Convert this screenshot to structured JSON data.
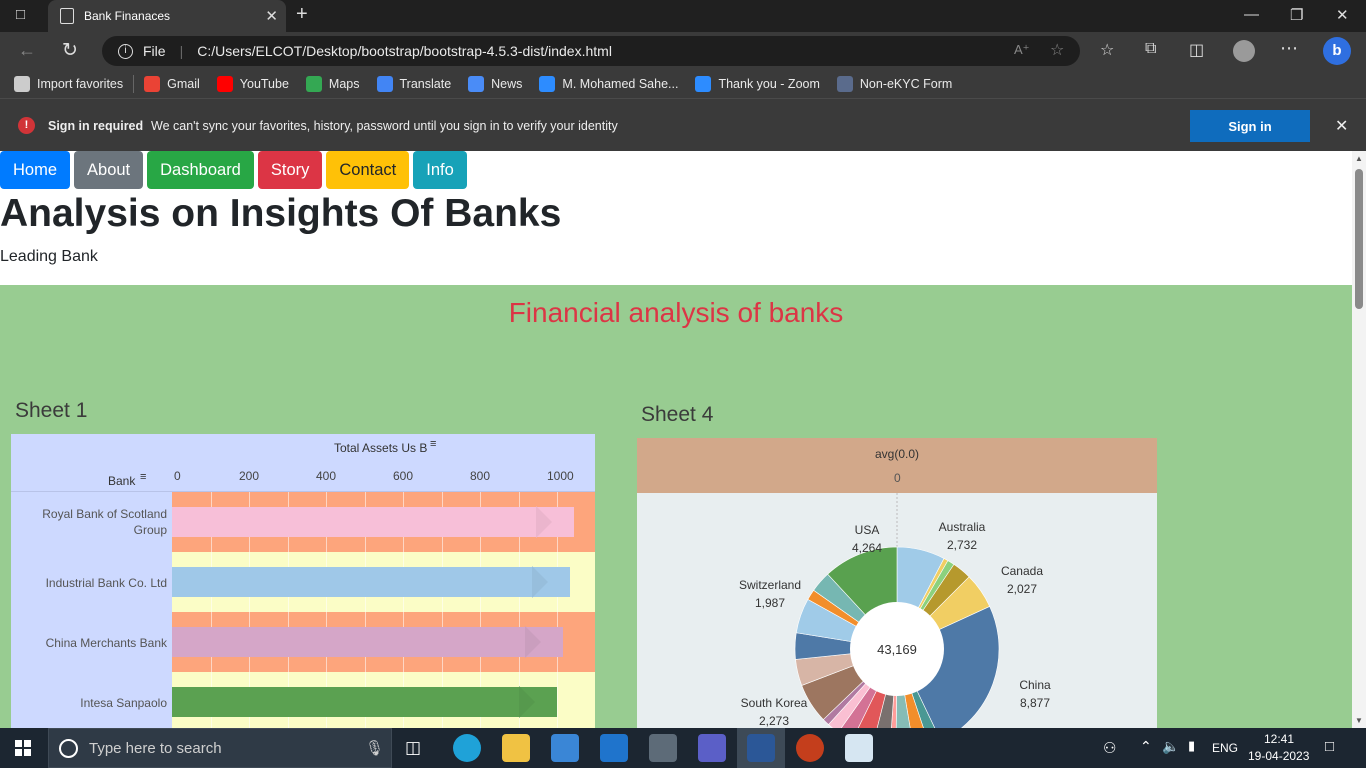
{
  "browser": {
    "tab_title": "Bank Finanaces",
    "url_scheme": "File",
    "url": "C:/Users/ELCOT/Desktop/bootstrap/bootstrap-4.5.3-dist/index.html",
    "bookmarks": [
      {
        "label": "Import favorites",
        "color": "#cccccc"
      },
      {
        "label": "Gmail",
        "color": "#ea4335"
      },
      {
        "label": "YouTube",
        "color": "#ff0000"
      },
      {
        "label": "Maps",
        "color": "#34a853"
      },
      {
        "label": "Translate",
        "color": "#4285f4"
      },
      {
        "label": "News",
        "color": "#4a8cf7"
      },
      {
        "label": "M. Mohamed Sahe...",
        "color": "#2d8cff"
      },
      {
        "label": "Thank you - Zoom",
        "color": "#2d8cff"
      },
      {
        "label": "Non-eKYC Form",
        "color": "#5a6b8c"
      }
    ],
    "sync": {
      "title": "Sign in required",
      "message": "We can't sync your favorites, history, password until you sign in to verify your identity",
      "button": "Sign in"
    }
  },
  "page": {
    "nav": [
      {
        "label": "Home",
        "color": "#007bff"
      },
      {
        "label": "About",
        "color": "#6c757d"
      },
      {
        "label": "Dashboard",
        "color": "#28a745"
      },
      {
        "label": "Story",
        "color": "#dc3545"
      },
      {
        "label": "Contact",
        "color": "#ffc107"
      },
      {
        "label": "Info",
        "color": "#17a2b8"
      }
    ],
    "heading": "Analysis on Insights Of Banks",
    "subheading": "Leading Bank",
    "section_title": "Financial analysis of banks",
    "sheet1_title": "Sheet 1",
    "sheet4_title": "Sheet 4"
  },
  "chart_data": [
    {
      "type": "bar",
      "orientation": "horizontal",
      "xlabel": "Total Assets Us B",
      "ylabel": "Bank",
      "xlim": [
        0,
        1100
      ],
      "ticks": [
        0,
        200,
        400,
        600,
        800,
        1000
      ],
      "categories": [
        "Royal Bank of Scotland Group",
        "Industrial Bank Co. Ltd",
        "China Merchants Bank",
        "Intesa Sanpaolo"
      ],
      "values": [
        1045,
        1035,
        1015,
        1000
      ],
      "colors": [
        "#f7bfd8",
        "#9fc8e8",
        "#d5a6c8",
        "#5ba151"
      ],
      "band_colors": [
        "#fda57c",
        "#fbfdc6"
      ]
    },
    {
      "type": "pie",
      "donut": true,
      "header": "avg(0.0)",
      "header_tick": "0",
      "center_label": "43,169",
      "labels": [
        {
          "name": "Australia",
          "value": "2,732"
        },
        {
          "name": "Canada",
          "value": "2,027"
        },
        {
          "name": "China",
          "value": "8,877"
        },
        {
          "name": "South Korea",
          "value": "2,273"
        },
        {
          "name": "Switzerland",
          "value": "1,987"
        },
        {
          "name": "USA",
          "value": "4,264"
        }
      ],
      "slices": [
        {
          "value": 2732,
          "color": "#a0cbe8"
        },
        {
          "value": 250,
          "color": "#f1ce63"
        },
        {
          "value": 400,
          "color": "#8cd17d"
        },
        {
          "value": 1100,
          "color": "#b6992d"
        },
        {
          "value": 2027,
          "color": "#f1ce63"
        },
        {
          "value": 8877,
          "color": "#4e79a7"
        },
        {
          "value": 700,
          "color": "#499894"
        },
        {
          "value": 900,
          "color": "#f28e2b"
        },
        {
          "value": 1000,
          "color": "#86bcb6"
        },
        {
          "value": 350,
          "color": "#ff9d9a"
        },
        {
          "value": 1000,
          "color": "#79706e"
        },
        {
          "value": 1200,
          "color": "#e15759"
        },
        {
          "value": 900,
          "color": "#d37295"
        },
        {
          "value": 700,
          "color": "#fabfd2"
        },
        {
          "value": 400,
          "color": "#b07aa1"
        },
        {
          "value": 2273,
          "color": "#9d7660"
        },
        {
          "value": 1500,
          "color": "#d7b5a6"
        },
        {
          "value": 1500,
          "color": "#4e79a7"
        },
        {
          "value": 1987,
          "color": "#a0cbe8"
        },
        {
          "value": 600,
          "color": "#f28e2b"
        },
        {
          "value": 1200,
          "color": "#76b7b2"
        },
        {
          "value": 4264,
          "color": "#59a14f"
        }
      ]
    }
  ],
  "taskbar": {
    "search_placeholder": "Type here to search",
    "language": "ENG",
    "time": "12:41",
    "date": "19-04-2023"
  }
}
